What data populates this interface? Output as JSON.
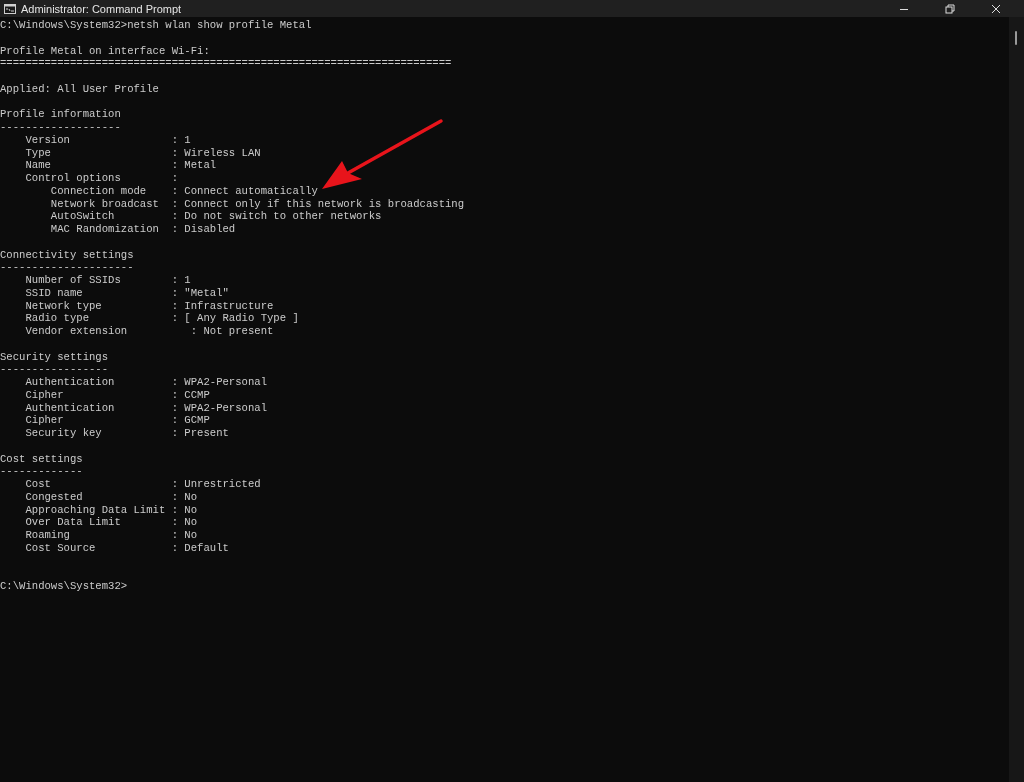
{
  "window": {
    "title": "Administrator: Command Prompt"
  },
  "console": {
    "blocks": [
      {
        "lines": [
          "C:\\Windows\\System32>netsh wlan show profile Metal"
        ]
      },
      {
        "lines": [
          "Profile Metal on interface Wi-Fi:",
          "======================================================================="
        ]
      },
      {
        "lines": [
          "Applied: All User Profile"
        ]
      },
      {
        "lines": [
          "Profile information",
          "-------------------",
          "    Version                : 1",
          "    Type                   : Wireless LAN",
          "    Name                   : Metal",
          "    Control options        :",
          "        Connection mode    : Connect automatically",
          "        Network broadcast  : Connect only if this network is broadcasting",
          "        AutoSwitch         : Do not switch to other networks",
          "        MAC Randomization  : Disabled"
        ]
      },
      {
        "lines": [
          "Connectivity settings",
          "---------------------",
          "    Number of SSIDs        : 1",
          "    SSID name              : \"Metal\"",
          "    Network type           : Infrastructure",
          "    Radio type             : [ Any Radio Type ]",
          "    Vendor extension          : Not present"
        ]
      },
      {
        "lines": [
          "Security settings",
          "-----------------",
          "    Authentication         : WPA2-Personal",
          "    Cipher                 : CCMP",
          "    Authentication         : WPA2-Personal",
          "    Cipher                 : GCMP",
          "    Security key           : Present"
        ]
      },
      {
        "lines": [
          "Cost settings",
          "-------------",
          "    Cost                   : Unrestricted",
          "    Congested              : No",
          "    Approaching Data Limit : No",
          "    Over Data Limit        : No",
          "    Roaming                : No",
          "    Cost Source            : Default"
        ]
      }
    ],
    "prompt": "C:\\Windows\\System32>"
  }
}
